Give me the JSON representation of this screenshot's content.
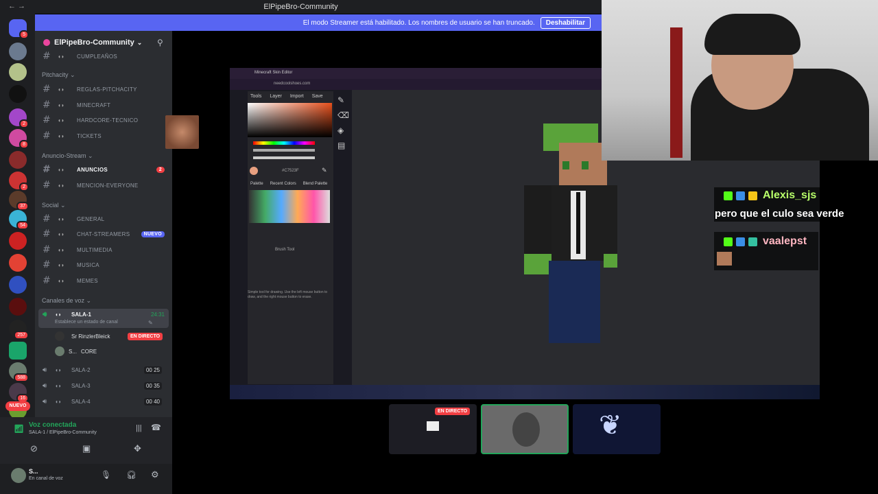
{
  "window": {
    "title": "ElPipeBro-Community",
    "nav": "← →"
  },
  "streamer_banner": {
    "text": "El modo Streamer está habilitado. Los nombres de usuario se han truncado.",
    "button": "Deshabilitar"
  },
  "server": {
    "name": "ElPipeBro-Community"
  },
  "categories": {
    "pitchacity": "Pitchacity",
    "anuncio": "Anuncio-Stream",
    "social": "Social",
    "voz": "Canales de voz"
  },
  "channels": {
    "cumpleanos": "CUMPLEAÑOS",
    "reglas": "REGLAS-PITCHACITY",
    "minecraft": "MINECRAFT",
    "hardcore": "HARDCORE-TECNICO",
    "tickets": "TICKETS",
    "anuncios": "ANUNCIOS",
    "anuncios_badge": "2",
    "mencion": "MENCION-EVERYONE",
    "general": "GENERAL",
    "chat_streamers": "CHAT-STREAMERS",
    "nuevo_badge": "NUEVO",
    "multimedia": "MULTIMEDIA",
    "musica": "MUSICA",
    "memes": "MEMES"
  },
  "voice_channels": {
    "sala1": "SALA-1",
    "sala1_time": "24:31",
    "sala1_status": "Establece un estado de canal",
    "user1": "Sr RinzlerBleick",
    "user1_live": "EN DIRECTO",
    "user2": "S...",
    "user2_tag": "CORE",
    "sala2": "SALA-2",
    "sala2_count": "00 25",
    "sala3": "SALA-3",
    "sala3_count": "00 35",
    "sala4": "SALA-4",
    "sala4_count": "00 40"
  },
  "guild_badges": [
    "5",
    "2",
    "8",
    "2",
    "37",
    "54",
    "257",
    "588",
    "16"
  ],
  "guild_new": "NUEVO",
  "voice_panel": {
    "status": "Voz conectada",
    "location": "SALA-1 / ElPipeBro-Community",
    "user": "S...",
    "user_status": "En canal de voz"
  },
  "editor": {
    "tab": "Minecraft Skin Editor",
    "url": "needcoolshoes.com",
    "tabs": [
      "Tools",
      "Layer",
      "Import",
      "Save"
    ],
    "hex": "#C7523F",
    "palette_tabs": [
      "Palette",
      "Recent Colors",
      "Blend Palette"
    ],
    "brush_title": "Brush Tool",
    "brush_help": "Simple tool for drawing. Use the left mouse button to draw, and the right mouse button to erase."
  },
  "chat": {
    "user1": "Alexis_sjs",
    "msg1": "pero que el culo sea verde",
    "user2": "vaalepst"
  },
  "stream_tiles": {
    "live": "EN DIRECTO"
  },
  "colors": {
    "blurple": "#5865f2",
    "red": "#f23f43",
    "green": "#23a55a"
  }
}
